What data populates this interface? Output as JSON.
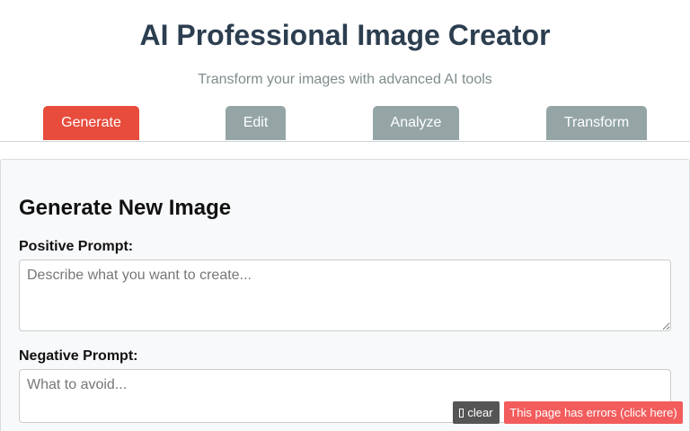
{
  "header": {
    "title": "AI Professional Image Creator",
    "subtitle": "Transform your images with advanced AI tools"
  },
  "tabs": [
    {
      "label": "Generate",
      "active": true
    },
    {
      "label": "Edit",
      "active": false
    },
    {
      "label": "Analyze",
      "active": false
    },
    {
      "label": "Transform",
      "active": false
    }
  ],
  "colors": {
    "active_tab": "#e74c3c",
    "inactive_tab": "#95a5a6",
    "title": "#2c3e50",
    "error_badge": "#f25c5c"
  },
  "generate_panel": {
    "title": "Generate New Image",
    "positive_label": "Positive Prompt:",
    "positive_value": "",
    "positive_placeholder": "Describe what you want to create...",
    "negative_label": "Negative Prompt:",
    "negative_value": "",
    "negative_placeholder": "What to avoid..."
  },
  "error_overlay": {
    "clear_label": "clear",
    "clear_icon": "box-icon",
    "error_label": "This page has errors (click here)"
  }
}
